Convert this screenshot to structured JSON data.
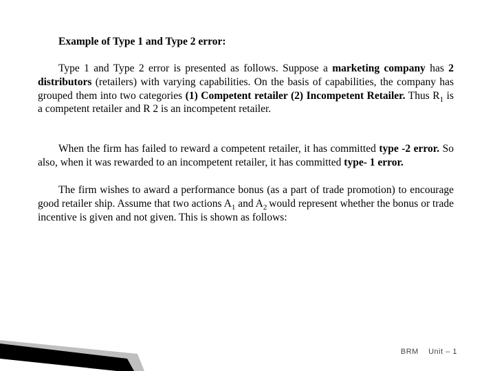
{
  "heading": "Example of Type 1 and Type 2 error:",
  "p1": {
    "s1a": "Type 1 and Type 2 error is presented as follows. Suppose a ",
    "s1b": "marketing company",
    "s1c": " has ",
    "s1d": "2 distributors",
    "s1e": " (retailers) with varying capabilities. On the basis of capabilities, the company has grouped them into two categories ",
    "s1f": "(1) Competent retailer (2) Incompetent Retailer.",
    "s1g": " Thus R",
    "s1h": "1",
    "s1i": " is a competent retailer and R 2 is an incompetent retailer."
  },
  "p2": {
    "s2a": "When the firm has failed to reward a competent retailer, it has committed ",
    "s2b": "type -2 error.",
    "s2c": " So also, when it was rewarded to an incompetent retailer, it has committed ",
    "s2d": "type- 1 error."
  },
  "p3": {
    "s3a": "The firm wishes to award a performance bonus (as a part of trade promotion) to encourage good retailer ship. Assume that two actions A",
    "s3b": "1",
    "s3c": " and A",
    "s3d": "2 ",
    "s3e": "would represent whether the bonus or trade incentive is given and not given. This is shown as follows:"
  },
  "footer": {
    "brm": "BRM",
    "unit": "Unit – 1"
  }
}
